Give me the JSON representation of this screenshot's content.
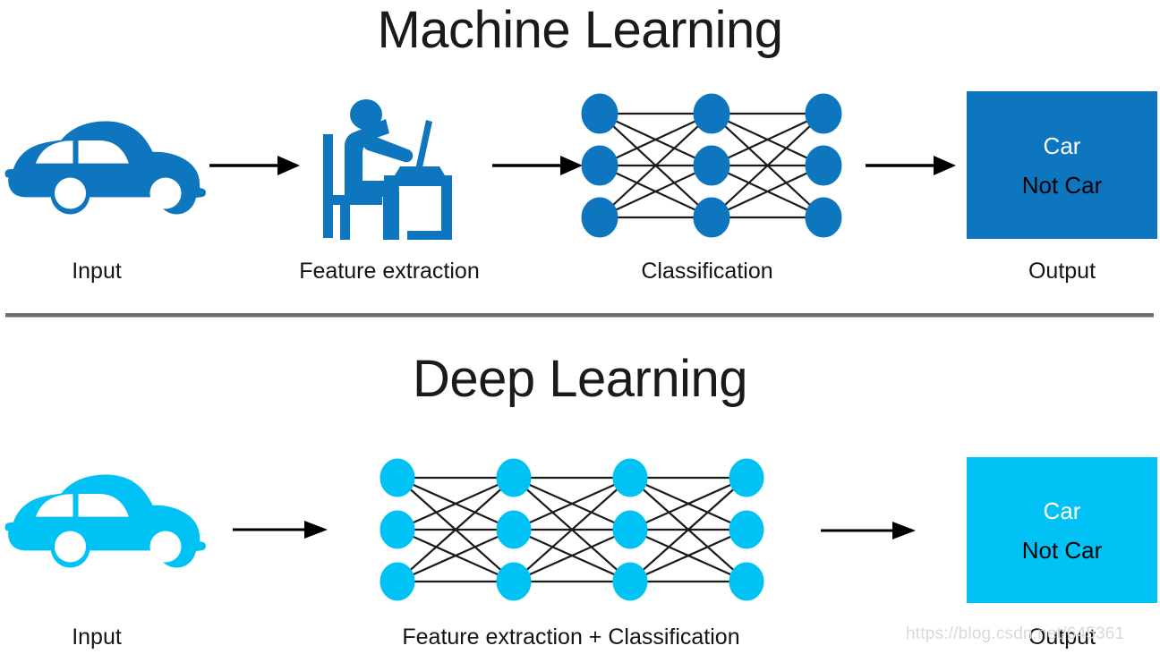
{
  "figure": {
    "watermark": "https://blog.csdn.net/645361"
  },
  "sections": [
    {
      "id": "machine-learning",
      "title": "Machine Learning",
      "accent_color": "#0d76bf",
      "stages": [
        {
          "name": "input",
          "label": "Input",
          "icon": "car-icon"
        },
        {
          "name": "feature-extraction",
          "label": "Feature extraction",
          "icon": "person-at-laptop-icon"
        },
        {
          "name": "classification",
          "label": "Classification",
          "icon": "neural-network-icon"
        },
        {
          "name": "output",
          "label": "Output",
          "icon": "output-box"
        }
      ],
      "network": {
        "layers": 3,
        "nodes_per_layer": 3,
        "node_color": "#0d76bf"
      },
      "output": {
        "positive_label": "Car",
        "negative_label": "Not Car"
      }
    },
    {
      "id": "deep-learning",
      "title": "Deep Learning",
      "accent_color": "#00c2f5",
      "stages": [
        {
          "name": "input",
          "label": "Input",
          "icon": "car-icon"
        },
        {
          "name": "feature-extraction-classification",
          "label": "Feature extraction + Classification",
          "icon": "neural-network-icon"
        },
        {
          "name": "output",
          "label": "Output",
          "icon": "output-box"
        }
      ],
      "network": {
        "layers": 4,
        "nodes_per_layer": 3,
        "node_color": "#00c2f5"
      },
      "output": {
        "positive_label": "Car",
        "negative_label": "Not Car"
      }
    }
  ],
  "colors": {
    "ml_blue": "#0d76bf",
    "dl_cyan": "#00c2f5",
    "arrow": "#000000",
    "divider": "#6e6e6e",
    "text": "#141414",
    "watermark": "#d9d9d9"
  }
}
